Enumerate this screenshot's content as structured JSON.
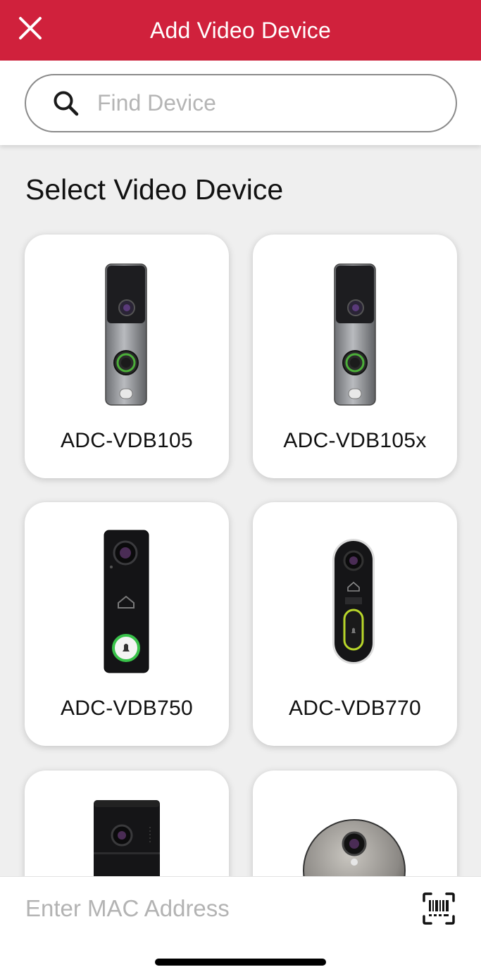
{
  "header": {
    "title": "Add Video Device",
    "close_icon": "close-icon",
    "background_color": "#d0213c"
  },
  "search": {
    "placeholder": "Find Device",
    "value": "",
    "icon": "search-icon"
  },
  "section": {
    "title": "Select Video Device"
  },
  "devices": [
    {
      "label": "ADC-VDB105",
      "icon": "slim-doorbell-silver"
    },
    {
      "label": "ADC-VDB105x",
      "icon": "slim-doorbell-silver"
    },
    {
      "label": "ADC-VDB750",
      "icon": "doorbell-black-rectangular"
    },
    {
      "label": "ADC-VDB770",
      "icon": "doorbell-black-rounded"
    },
    {
      "label": "",
      "icon": "doorbell-black-wide"
    },
    {
      "label": "",
      "icon": "doorbell-round-silver"
    }
  ],
  "bottom": {
    "mac_placeholder": "Enter MAC Address",
    "mac_value": "",
    "scan_icon": "barcode-scan-icon"
  }
}
